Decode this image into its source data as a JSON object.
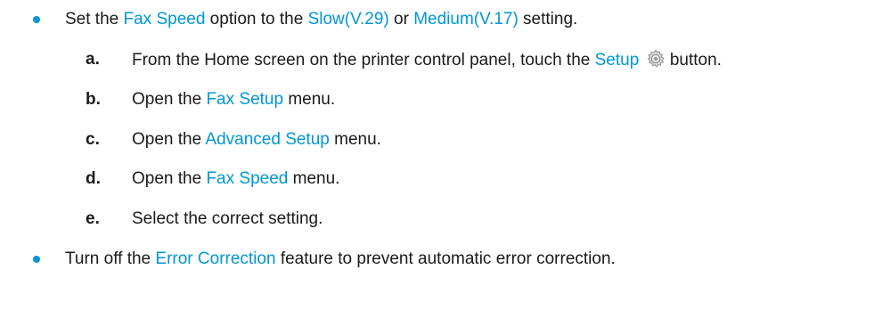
{
  "bullet1": {
    "t1": "Set the ",
    "h1": "Fax Speed",
    "t2": " option to the ",
    "h2": "Slow(V.29)",
    "t3": " or ",
    "h3": "Medium(V.17)",
    "t4": " setting."
  },
  "steps": [
    {
      "letter": "a.",
      "t1": "From the Home screen on the printer control panel, touch the ",
      "h1": "Setup",
      "icon": "gear-icon",
      "t2": " button."
    },
    {
      "letter": "b.",
      "t1": "Open the ",
      "h1": "Fax Setup",
      "t2": " menu."
    },
    {
      "letter": "c.",
      "t1": "Open the ",
      "h1": "Advanced Setup",
      "t2": " menu."
    },
    {
      "letter": "d.",
      "t1": "Open the ",
      "h1": "Fax Speed",
      "t2": " menu."
    },
    {
      "letter": "e.",
      "t1": "Select the correct setting."
    }
  ],
  "bullet2": {
    "t1": "Turn off the ",
    "h1": "Error Correction",
    "t2": " feature to prevent automatic error correction."
  },
  "colors": {
    "link": "#0096d6",
    "text": "#1a1a1a"
  }
}
